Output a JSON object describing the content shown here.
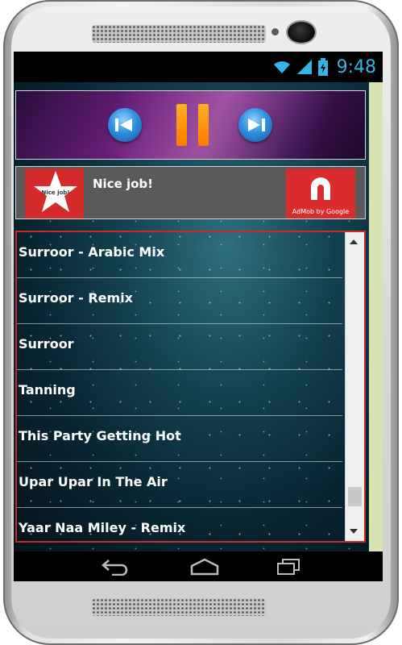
{
  "status_bar": {
    "time": "9:48",
    "icons": [
      "wifi-icon",
      "signal-icon",
      "battery-charging-icon"
    ],
    "accent_color": "#33b5e5"
  },
  "player": {
    "controls": [
      "previous-icon",
      "pause-icon",
      "next-icon"
    ]
  },
  "ad": {
    "headline": "Nice job!",
    "logo_text": "Nice job!",
    "badge_caption": "AdMob by Google"
  },
  "songs": [
    "Surroor - Arabic Mix",
    "Surroor - Remix",
    "Surroor",
    "Tanning",
    "This Party Getting Hot",
    "Upar Upar In The Air",
    "Yaar Naa Miley - Remix"
  ],
  "scrollbar": {
    "position_fraction": 0.9
  },
  "colors": {
    "list_border": "#c62a2a",
    "pause_button": "#ff9a10",
    "skip_buttons": "#2f8fe0",
    "ad_badge": "#d92d2d"
  }
}
